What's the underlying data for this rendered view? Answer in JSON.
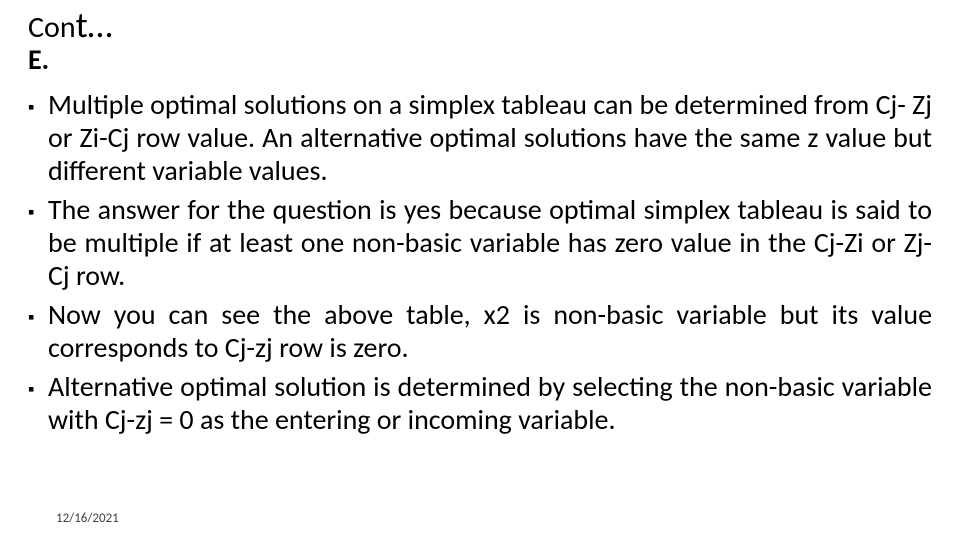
{
  "title": {
    "prefix": "Con",
    "suffix": "t…"
  },
  "section_label": "E.",
  "bullets": [
    "Multiple optimal solutions on a simplex tableau can be determined from Cj- Zj or Zi-Cj row value. An alternative optimal solutions have the same z value but different variable values.",
    "The answer for the question is yes because optimal simplex tableau is said to be multiple if at least one non-basic variable has zero value in the Cj-Zi or Zj-Cj row.",
    "Now you can see the above table, x2 is non-basic variable but its value corresponds to Cj-zj   row is zero.",
    "Alternative optimal solution is determined by selecting the non-basic variable with Cj-zj  = 0 as the entering or incoming variable."
  ],
  "footer": {
    "date": "12/16/2021"
  },
  "marker": "▪"
}
